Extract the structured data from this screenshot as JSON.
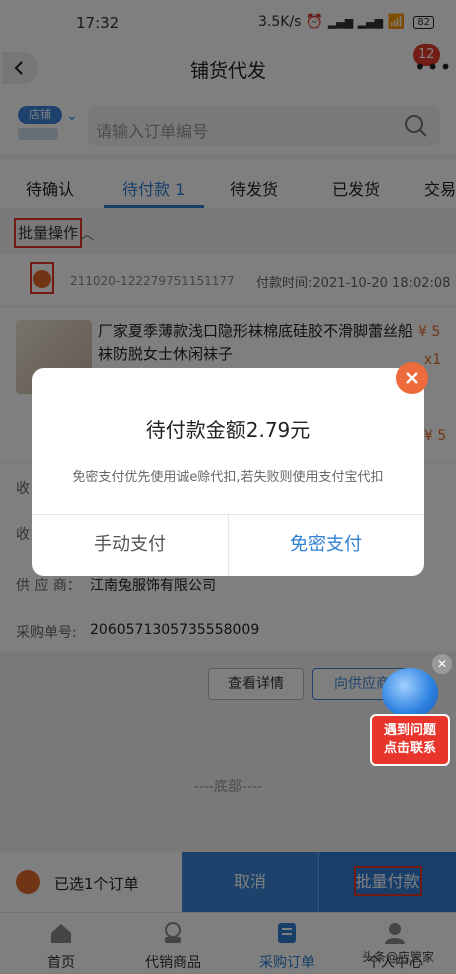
{
  "status_bar": {
    "time": "17:32",
    "speed": "3.5K/s",
    "battery": "82"
  },
  "navbar": {
    "title": "铺货代发",
    "badge": "12"
  },
  "shop": {
    "tag": "店铺"
  },
  "search": {
    "placeholder": "请输入订单编号"
  },
  "tabs": [
    {
      "label": "待确认"
    },
    {
      "label": "待付款 1",
      "active": true
    },
    {
      "label": "待发货"
    },
    {
      "label": "已发货"
    },
    {
      "label": "交易"
    }
  ],
  "bulk_ops": {
    "label": "批量操作"
  },
  "order": {
    "order_no": "211020-122279751151177",
    "pay_time": "付款时间:2021-10-20 18:02:08",
    "product_title": "厂家夏季薄款浅口隐形袜棉底硅胶不滑脚蕾丝船袜防脱女士休闲袜子",
    "price": "¥ 5",
    "qty": "x1",
    "price2": "¥ 5",
    "row_label_1": "收",
    "row_label_2": "收",
    "supplier_label": "供 应 商：",
    "supplier_value": "江南兔服饰有限公司",
    "po_label": "采购单号:",
    "po_value": "2060571305735558009",
    "btn_detail": "查看详情",
    "btn_contact": "向供应商"
  },
  "bottom_marker": "----底部----",
  "action_bar": {
    "selected": "已选1个订单",
    "cancel": "取消",
    "batch_pay": "批量付款"
  },
  "tabbar": [
    {
      "label": "首页",
      "icon": "home-icon"
    },
    {
      "label": "代销商品",
      "icon": "goods-icon"
    },
    {
      "label": "采购订单",
      "icon": "orders-icon",
      "active": true
    },
    {
      "label": "个人中心",
      "icon": "user-icon"
    }
  ],
  "watermark": "头条@店管家",
  "modal": {
    "title": "待付款金额2.79元",
    "desc": "免密支付优先使用诚e赊代扣,若失败则使用支付宝代扣",
    "manual": "手动支付",
    "no_password": "免密支付"
  },
  "help": {
    "line1": "遇到问题",
    "line2": "点击联系"
  },
  "colors": {
    "accent": "#2f7fd3",
    "highlight": "#e8352b",
    "orange": "#e36b2a"
  }
}
